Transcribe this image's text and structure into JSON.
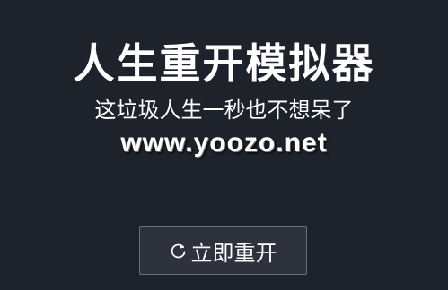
{
  "app": {
    "title": "人生重开模拟器",
    "subtitle": "这垃圾人生一秒也不想呆了"
  },
  "watermark": {
    "text": "www.yoozo.net"
  },
  "actions": {
    "restart_label": "立即重开",
    "restart_icon": "refresh-icon"
  },
  "colors": {
    "background": "#1e222b",
    "button_background": "#2d323c",
    "button_border": "#6a707c",
    "text": "#ffffff"
  }
}
